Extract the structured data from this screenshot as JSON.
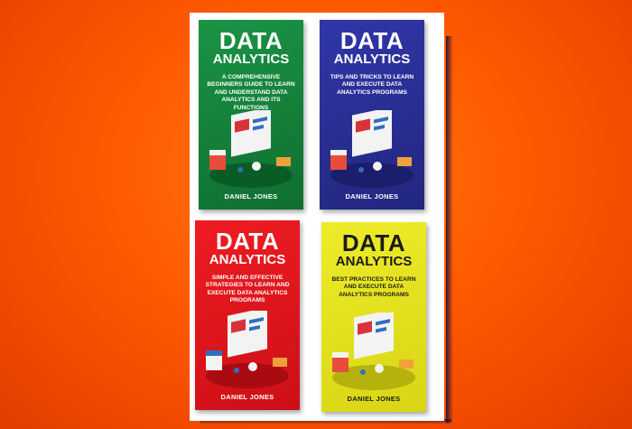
{
  "books": [
    {
      "title": "DATA",
      "subtitle": "ANALYTICS",
      "description": "A COMPREHENSIVE BEGINNERS GUIDE TO LEARN AND UNDERSTAND DATA ANALYTICS AND ITS FUNCTIONS",
      "author": "DANIEL JONES",
      "cover_color": "#13803a"
    },
    {
      "title": "DATA",
      "subtitle": "ANALYTICS",
      "description": "TIPS AND TRICKS TO LEARN AND EXECUTE DATA ANALYTICS PROGRAMS",
      "author": "DANIEL JONES",
      "cover_color": "#2a2f96"
    },
    {
      "title": "DATA",
      "subtitle": "ANALYTICS",
      "description": "SIMPLE AND EFFECTIVE STRATEGIES TO LEARN AND EXECUTE DATA ANALYTICS PROGRAMS",
      "author": "DANIEL JONES",
      "cover_color": "#e0151b"
    },
    {
      "title": "DATA",
      "subtitle": "ANALYTICS",
      "description": "BEST PRACTICES TO LEARN AND EXECUTE DATA ANALYTICS PROGRAMS",
      "author": "DANIEL JONES",
      "cover_color": "#e4e21a"
    }
  ],
  "background_color": "#ff5a00"
}
